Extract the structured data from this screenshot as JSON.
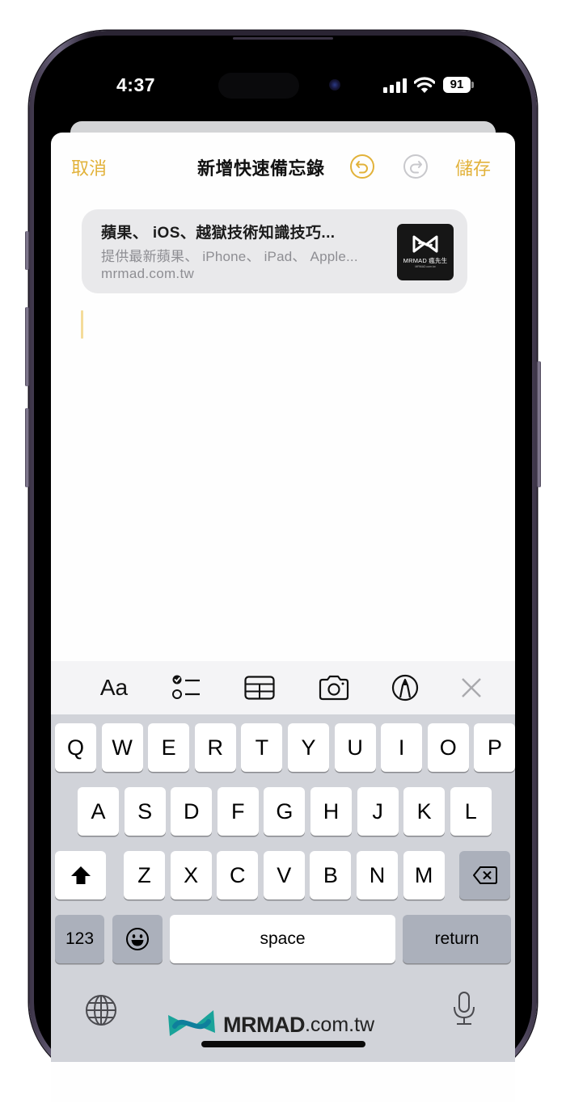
{
  "status_bar": {
    "time": "4:37",
    "battery_level": "91",
    "signal_icon": "cellular-signal-icon",
    "wifi_icon": "wifi-icon"
  },
  "nav": {
    "cancel_label": "取消",
    "title": "新增快速備忘錄",
    "save_label": "儲存",
    "undo_icon": "undo-icon",
    "redo_icon": "redo-icon"
  },
  "colors": {
    "accent": "#e2b23a",
    "keyboard_bg": "#d1d3d9",
    "special_key": "#abb0bb",
    "link_card_bg": "#e9e9eb",
    "watermark_teal": "#1aa39a"
  },
  "link_preview": {
    "title": "蘋果、 iOS、越獄技術知識技巧...",
    "description": "提供最新蘋果、 iPhone、 iPad、 Apple...",
    "domain": "mrmad.com.tw",
    "thumbnail": {
      "brand": "MRMAD 瘋先生",
      "sub": "MRMAD.com.tw"
    }
  },
  "toolbar": {
    "format_label": "Aa",
    "items": [
      "text-format",
      "checklist-icon",
      "table-icon",
      "camera-icon",
      "markup-icon",
      "close-icon"
    ]
  },
  "keyboard": {
    "row1": [
      "Q",
      "W",
      "E",
      "R",
      "T",
      "Y",
      "U",
      "I",
      "O",
      "P"
    ],
    "row2": [
      "A",
      "S",
      "D",
      "F",
      "G",
      "H",
      "J",
      "K",
      "L"
    ],
    "row3": [
      "Z",
      "X",
      "C",
      "V",
      "B",
      "N",
      "M"
    ],
    "numbers_label": "123",
    "space_label": "space",
    "return_label": "return"
  },
  "watermark": {
    "bold": "MRMAD",
    "rest": ".com.tw"
  }
}
